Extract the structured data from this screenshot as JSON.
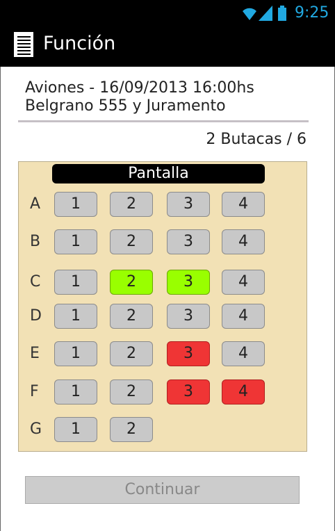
{
  "status_bar": {
    "time": "9:25",
    "accent_color": "#21a9e1",
    "icons": [
      "wifi-icon",
      "signal-icon",
      "battery-icon"
    ]
  },
  "app_bar": {
    "title": "Función",
    "menu_icon": "menu-icon"
  },
  "event": {
    "line1": "Aviones - 16/09/2013 16:00hs",
    "line2": "Belgrano 555 y Juramento"
  },
  "seat_count": "2 Butacas / 6",
  "hall": {
    "screen_label": "Pantalla",
    "rows": [
      {
        "label": "A",
        "seats": [
          {
            "n": "1",
            "state": "free"
          },
          {
            "n": "2",
            "state": "free"
          },
          {
            "n": "3",
            "state": "free"
          },
          {
            "n": "4",
            "state": "free"
          }
        ]
      },
      {
        "label": "B",
        "seats": [
          {
            "n": "1",
            "state": "free"
          },
          {
            "n": "2",
            "state": "free"
          },
          {
            "n": "3",
            "state": "free"
          },
          {
            "n": "4",
            "state": "free"
          }
        ]
      },
      {
        "label": "C",
        "seats": [
          {
            "n": "1",
            "state": "free"
          },
          {
            "n": "2",
            "state": "selected"
          },
          {
            "n": "3",
            "state": "selected"
          },
          {
            "n": "4",
            "state": "free"
          }
        ]
      },
      {
        "label": "D",
        "seats": [
          {
            "n": "1",
            "state": "free"
          },
          {
            "n": "2",
            "state": "free"
          },
          {
            "n": "3",
            "state": "free"
          },
          {
            "n": "4",
            "state": "free"
          }
        ]
      },
      {
        "label": "E",
        "seats": [
          {
            "n": "1",
            "state": "free"
          },
          {
            "n": "2",
            "state": "free"
          },
          {
            "n": "3",
            "state": "taken"
          },
          {
            "n": "4",
            "state": "free"
          }
        ]
      },
      {
        "label": "F",
        "seats": [
          {
            "n": "1",
            "state": "free"
          },
          {
            "n": "2",
            "state": "free"
          },
          {
            "n": "3",
            "state": "taken"
          },
          {
            "n": "4",
            "state": "taken"
          }
        ]
      },
      {
        "label": "G",
        "seats": [
          {
            "n": "1",
            "state": "free"
          },
          {
            "n": "2",
            "state": "free"
          }
        ]
      }
    ],
    "colors": {
      "free": "#c8c8c8",
      "selected": "#99ff00",
      "taken": "#ef3535",
      "background": "#f2e1b5"
    }
  },
  "continue_button": {
    "label": "Continuar"
  }
}
